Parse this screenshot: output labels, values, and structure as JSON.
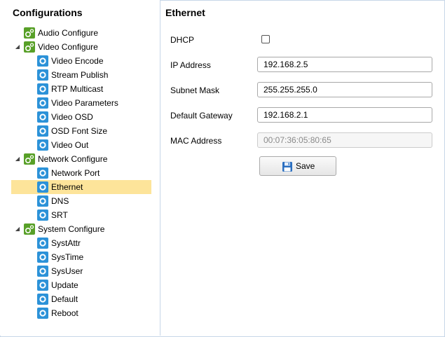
{
  "sidebar": {
    "title": "Configurations",
    "groups": [
      {
        "label": "Audio Configure",
        "icon": "gear-group-icon",
        "items": []
      },
      {
        "label": "Video Configure",
        "icon": "gear-group-icon",
        "items": [
          "Video Encode",
          "Stream Publish",
          "RTP Multicast",
          "Video Parameters",
          "Video OSD",
          "OSD Font Size",
          "Video Out"
        ]
      },
      {
        "label": "Network Configure",
        "icon": "gear-group-icon",
        "items": [
          "Network Port",
          "Ethernet",
          "DNS",
          "SRT"
        ]
      },
      {
        "label": "System Configure",
        "icon": "gear-group-icon",
        "items": [
          "SystAttr",
          "SysTime",
          "SysUser",
          "Update",
          "Default",
          "Reboot"
        ]
      }
    ],
    "selected": "Ethernet"
  },
  "main": {
    "title": "Ethernet",
    "dhcp_label": "DHCP",
    "dhcp_checked": false,
    "ip_label": "IP Address",
    "ip_value": "192.168.2.5",
    "subnet_label": "Subnet Mask",
    "subnet_value": "255.255.255.0",
    "gateway_label": "Default Gateway",
    "gateway_value": "192.168.2.1",
    "mac_label": "MAC Address",
    "mac_value": "00:07:36:05:80:65",
    "save_label": "Save"
  },
  "colors": {
    "selected_bg": "#fde49a",
    "group_icon": "#58a028",
    "item_icon": "#2c92d8",
    "border": "#c7d6e8"
  }
}
